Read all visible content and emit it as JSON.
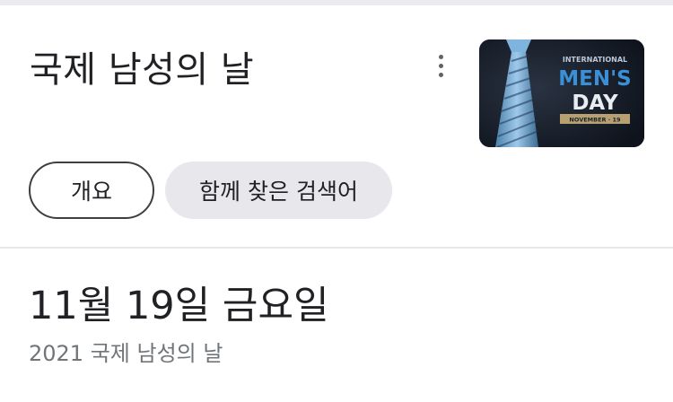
{
  "header": {
    "title": "국제 남성의 날",
    "more_icon": "more-vert-icon"
  },
  "thumbnail": {
    "line1": "INTERNATIONAL",
    "line2": "MEN'S",
    "line3": "DAY",
    "badge": "NOVEMBER · 19",
    "colors": {
      "background": "#1b2230",
      "accent": "#3a8fd6",
      "badge": "#b8a070"
    }
  },
  "chips": [
    {
      "label": "개요"
    },
    {
      "label": "함께 찾은 검색어"
    }
  ],
  "result": {
    "date": "11월 19일 금요일",
    "subtitle": "2021 국제 남성의 날"
  }
}
